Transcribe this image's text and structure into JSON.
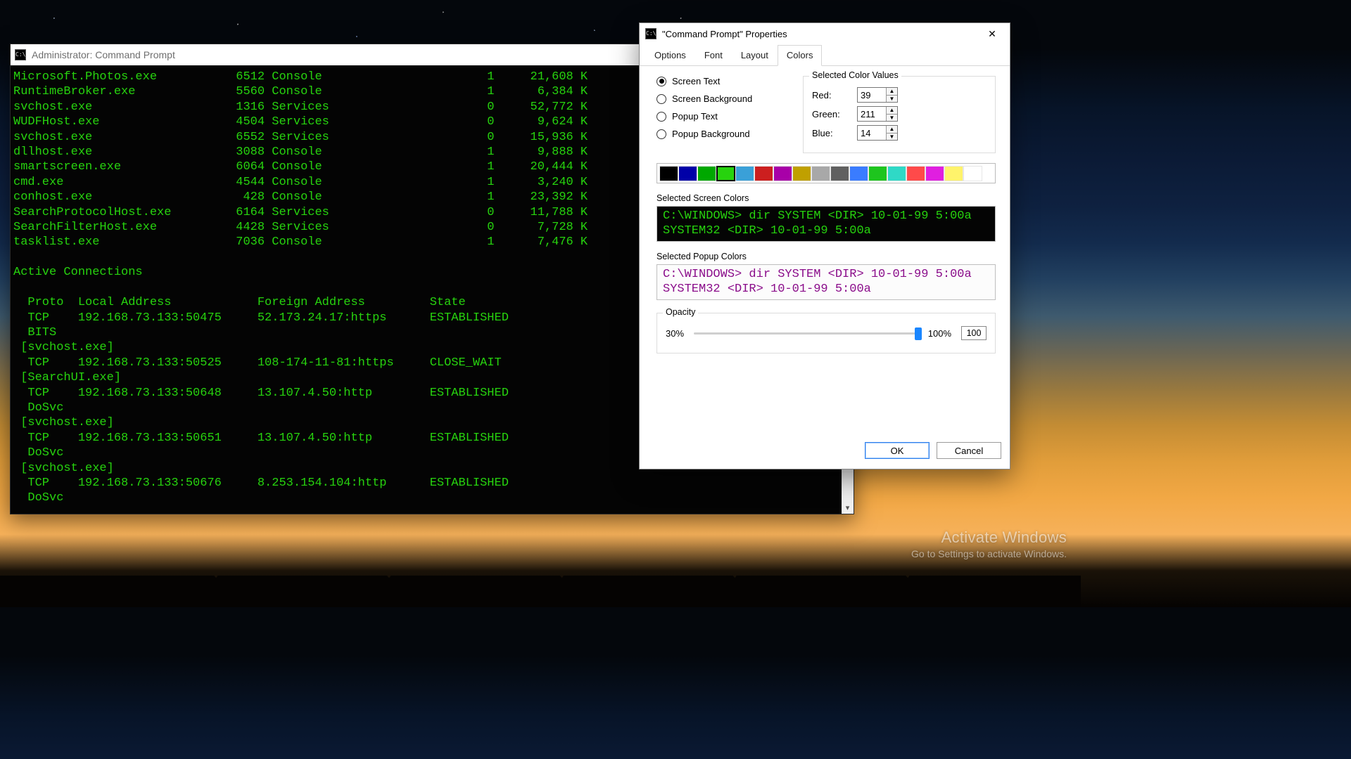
{
  "cmd": {
    "title": "Administrator: Command Prompt",
    "tasks": [
      {
        "name": "Microsoft.Photos.exe",
        "pid": "6512",
        "sess": "Console",
        "snum": "1",
        "mem": "21,608 K"
      },
      {
        "name": "RuntimeBroker.exe",
        "pid": "5560",
        "sess": "Console",
        "snum": "1",
        "mem": "6,384 K"
      },
      {
        "name": "svchost.exe",
        "pid": "1316",
        "sess": "Services",
        "snum": "0",
        "mem": "52,772 K"
      },
      {
        "name": "WUDFHost.exe",
        "pid": "4504",
        "sess": "Services",
        "snum": "0",
        "mem": "9,624 K"
      },
      {
        "name": "svchost.exe",
        "pid": "6552",
        "sess": "Services",
        "snum": "0",
        "mem": "15,936 K"
      },
      {
        "name": "dllhost.exe",
        "pid": "3088",
        "sess": "Console",
        "snum": "1",
        "mem": "9,888 K"
      },
      {
        "name": "smartscreen.exe",
        "pid": "6064",
        "sess": "Console",
        "snum": "1",
        "mem": "20,444 K"
      },
      {
        "name": "cmd.exe",
        "pid": "4544",
        "sess": "Console",
        "snum": "1",
        "mem": "3,240 K"
      },
      {
        "name": "conhost.exe",
        "pid": "428",
        "sess": "Console",
        "snum": "1",
        "mem": "23,392 K"
      },
      {
        "name": "SearchProtocolHost.exe",
        "pid": "6164",
        "sess": "Services",
        "snum": "0",
        "mem": "11,788 K"
      },
      {
        "name": "SearchFilterHost.exe",
        "pid": "4428",
        "sess": "Services",
        "snum": "0",
        "mem": "7,728 K"
      },
      {
        "name": "tasklist.exe",
        "pid": "7036",
        "sess": "Console",
        "snum": "1",
        "mem": "7,476 K"
      }
    ],
    "active_heading": "Active Connections",
    "net_header": {
      "proto": "Proto",
      "local": "Local Address",
      "foreign": "Foreign Address",
      "state": "State"
    },
    "conns": [
      {
        "proto": "TCP",
        "local": "192.168.73.133:50475",
        "foreign": "52.173.24.17:https",
        "state": "ESTABLISHED",
        "svc": "BITS",
        "owner": "[svchost.exe]"
      },
      {
        "proto": "TCP",
        "local": "192.168.73.133:50525",
        "foreign": "108-174-11-81:https",
        "state": "CLOSE_WAIT",
        "svc": null,
        "owner": "[SearchUI.exe]"
      },
      {
        "proto": "TCP",
        "local": "192.168.73.133:50648",
        "foreign": "13.107.4.50:http",
        "state": "ESTABLISHED",
        "svc": "DoSvc",
        "owner": "[svchost.exe]"
      },
      {
        "proto": "TCP",
        "local": "192.168.73.133:50651",
        "foreign": "13.107.4.50:http",
        "state": "ESTABLISHED",
        "svc": "DoSvc",
        "owner": "[svchost.exe]"
      },
      {
        "proto": "TCP",
        "local": "192.168.73.133:50676",
        "foreign": "8.253.154.104:http",
        "state": "ESTABLISHED",
        "svc": "DoSvc",
        "owner": null
      }
    ]
  },
  "props": {
    "title": "\"Command Prompt\" Properties",
    "tabs": [
      "Options",
      "Font",
      "Layout",
      "Colors"
    ],
    "active_tab": "Colors",
    "radios": [
      "Screen Text",
      "Screen Background",
      "Popup Text",
      "Popup Background"
    ],
    "selected_radio": "Screen Text",
    "scv_legend": "Selected Color Values",
    "red_label": "Red:",
    "green_label": "Green:",
    "blue_label": "Blue:",
    "red": "39",
    "green": "211",
    "blue": "14",
    "swatches": [
      "#000000",
      "#0000a8",
      "#00a800",
      "#27d30e",
      "#3aa0d8",
      "#cc1f1f",
      "#a800a8",
      "#c0a000",
      "#a8a8a8",
      "#606060",
      "#3a7cff",
      "#1ec51e",
      "#2fd9c6",
      "#ff4a4a",
      "#e01fe0",
      "#fff36b",
      "#ffffff"
    ],
    "selected_swatch": 3,
    "screen_legend": "Selected Screen Colors",
    "popup_legend": "Selected Popup Colors",
    "preview": [
      "C:\\WINDOWS> dir",
      "SYSTEM       <DIR>     10-01-99   5:00a",
      "SYSTEM32     <DIR>     10-01-99   5:00a"
    ],
    "opacity_legend": "Opacity",
    "op_min": "30%",
    "op_max": "100%",
    "op_val": "100",
    "ok": "OK",
    "cancel": "Cancel"
  },
  "watermark": {
    "l1": "Activate Windows",
    "l2": "Go to Settings to activate Windows."
  }
}
